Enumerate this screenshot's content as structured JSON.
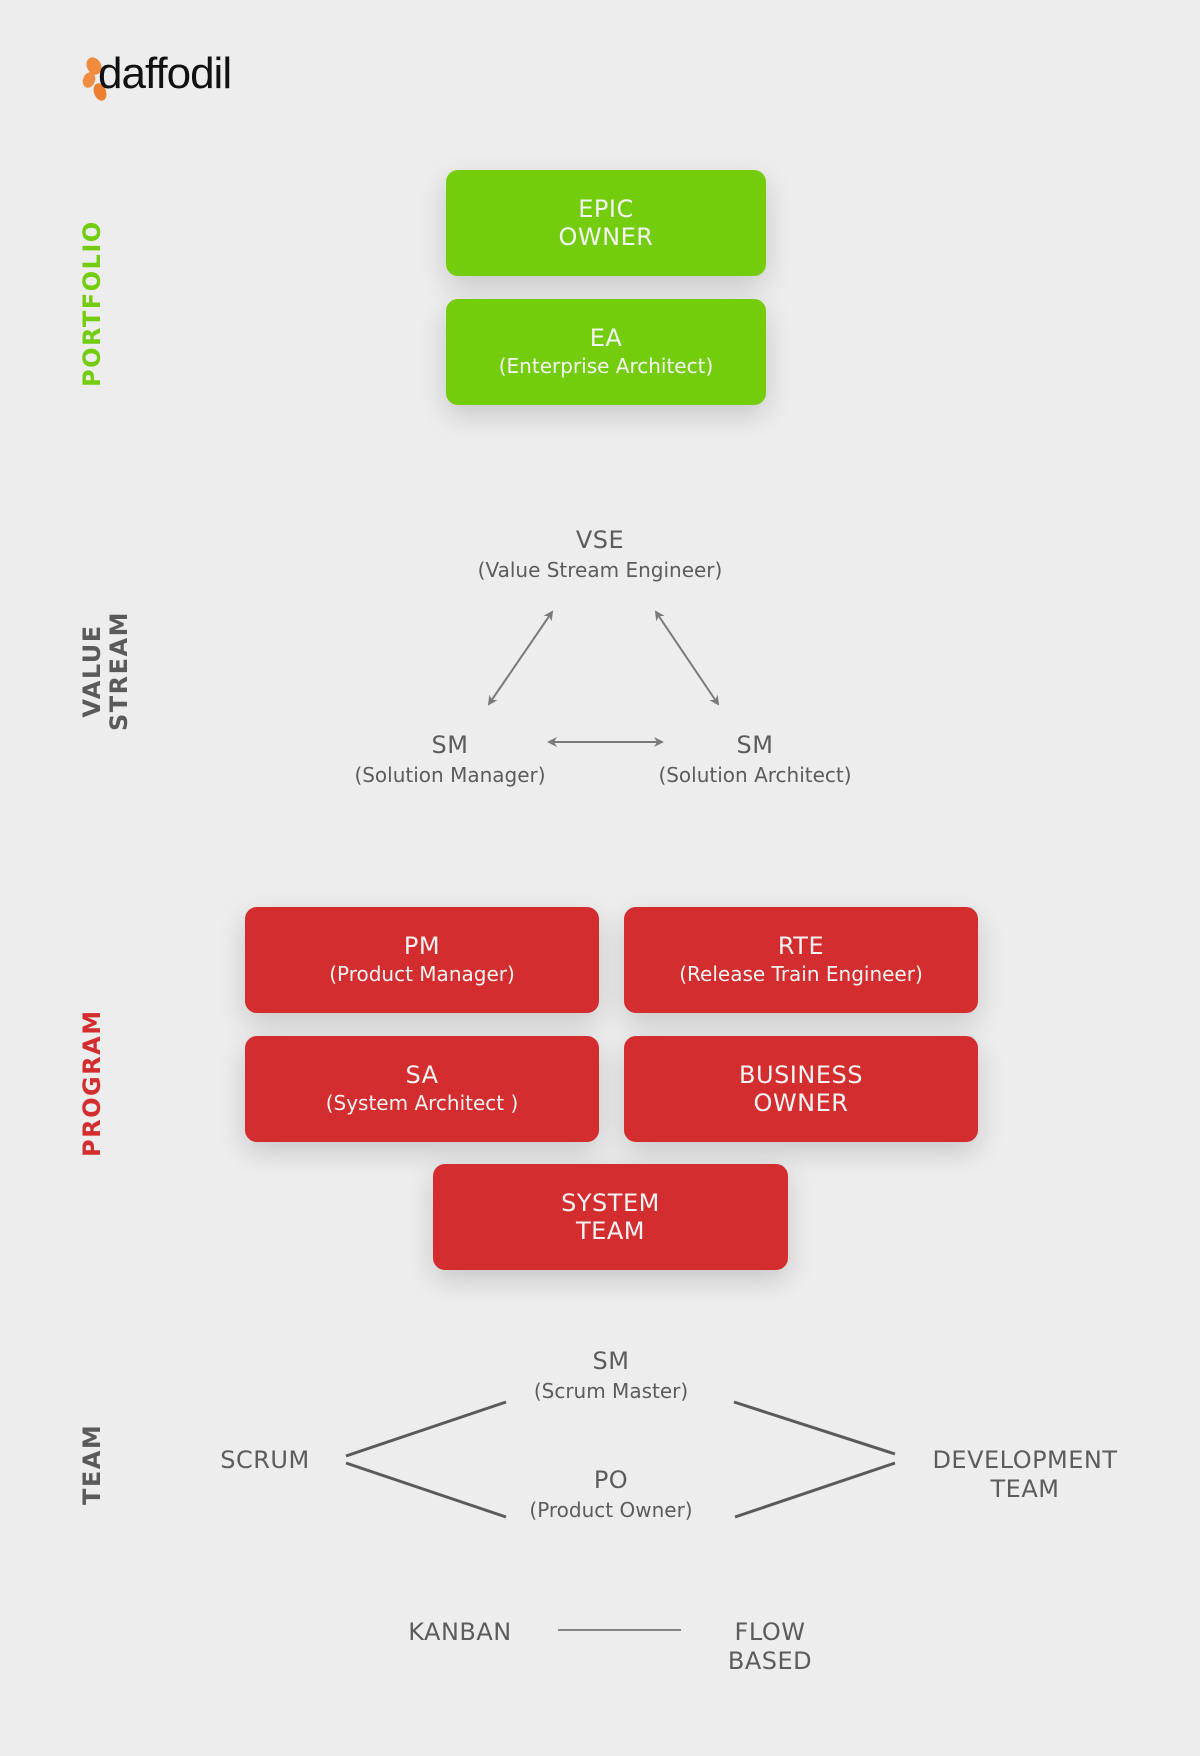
{
  "brand": {
    "logo_text": "daffodil",
    "logo_icon": "daffodil-flower-icon",
    "logo_color": "#f08a3c"
  },
  "colors": {
    "portfolio": "#74cd0c",
    "program": "#d42d2f",
    "neutral_text": "#5c5c5c",
    "connector": "#7a7a7a",
    "background": "#ededed"
  },
  "sections": {
    "portfolio": {
      "label": "PORTFOLIO",
      "roles": [
        {
          "title": "EPIC",
          "subtitle": "OWNER"
        },
        {
          "title": "EA",
          "subtitle": "(Enterprise Architect)"
        }
      ]
    },
    "value_stream": {
      "label_line1": "VALUE",
      "label_line2": "STREAM",
      "roles": [
        {
          "title": "VSE",
          "subtitle": "(Value Stream Engineer)"
        },
        {
          "title": "SM",
          "subtitle": "(Solution Manager)"
        },
        {
          "title": "SM",
          "subtitle": "(Solution Architect)"
        }
      ]
    },
    "program": {
      "label": "PROGRAM",
      "roles": [
        {
          "title": "PM",
          "subtitle": "(Product Manager)"
        },
        {
          "title": "RTE",
          "subtitle": "(Release Train Engineer)"
        },
        {
          "title": "SA",
          "subtitle": "(System Architect )"
        },
        {
          "title": "BUSINESS",
          "subtitle": "OWNER"
        },
        {
          "title": "SYSTEM",
          "subtitle": "TEAM"
        }
      ]
    },
    "team": {
      "label": "TEAM",
      "scrum": "SCRUM",
      "scrum_master": {
        "title": "SM",
        "subtitle": "(Scrum Master)"
      },
      "product_owner": {
        "title": "PO",
        "subtitle": "(Product Owner)"
      },
      "development_team": {
        "line1": "DEVELOPMENT",
        "line2": "TEAM"
      },
      "kanban": "KANBAN",
      "flow_based": {
        "line1": "FLOW",
        "line2": "BASED"
      }
    }
  }
}
